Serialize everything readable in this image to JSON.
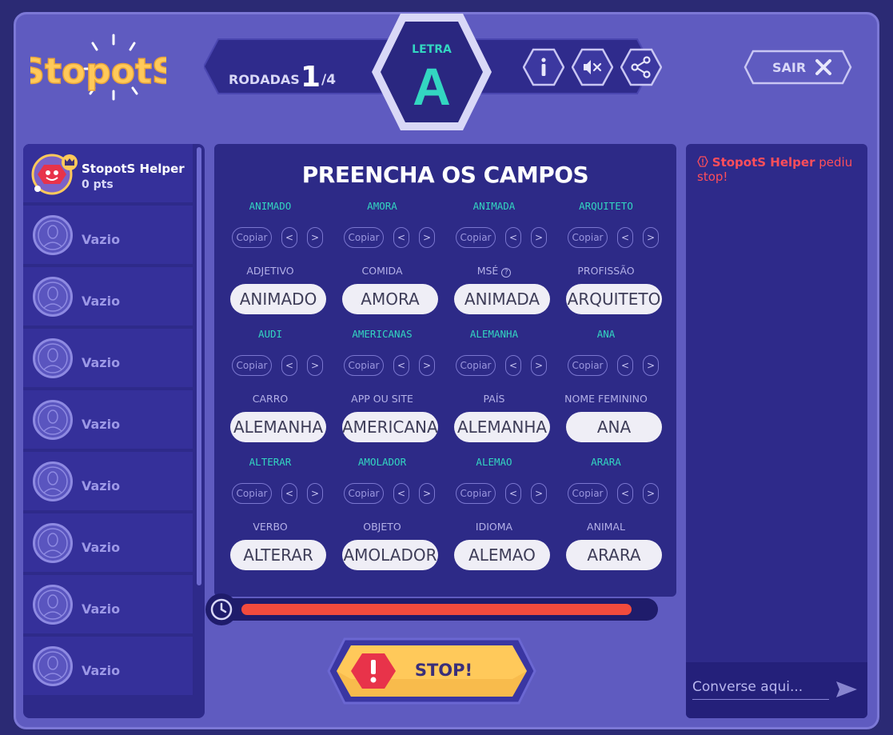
{
  "header": {
    "logo_text": "StopotS",
    "rounds_label": "RODADAS",
    "rounds_current": "1",
    "rounds_total": "/4",
    "letter_label": "LETRA",
    "letter": "A",
    "exit_label": "SAIR"
  },
  "icons": {
    "info": "info-icon",
    "sound": "mute-icon",
    "share": "share-icon",
    "close": "close-icon",
    "clock": "clock-icon",
    "alert": "exclamation-icon",
    "send": "send-icon",
    "crown": "crown-icon"
  },
  "players": [
    {
      "name": "StopotS Helper",
      "points": "0 pts"
    },
    {
      "name": "Vazio"
    },
    {
      "name": "Vazio"
    },
    {
      "name": "Vazio"
    },
    {
      "name": "Vazio"
    },
    {
      "name": "Vazio"
    },
    {
      "name": "Vazio"
    },
    {
      "name": "Vazio"
    },
    {
      "name": "Vazio"
    }
  ],
  "board": {
    "title": "PREENCHA OS CAMPOS",
    "copy_label": "Copiar",
    "prev_label": "<",
    "next_label": ">",
    "fields": [
      {
        "suggestion": "ANIMADO",
        "category": "ADJETIVO",
        "answer": "ANIMADO"
      },
      {
        "suggestion": "AMORA",
        "category": "COMIDA",
        "answer": "AMORA"
      },
      {
        "suggestion": "ANIMADA",
        "category": "MSÉ",
        "answer": "ANIMADA",
        "help": "?"
      },
      {
        "suggestion": "ARQUITETO",
        "category": "PROFISSÃO",
        "answer": "ARQUITETO"
      },
      {
        "suggestion": "AUDI",
        "category": "CARRO",
        "answer": "ALEMANHA"
      },
      {
        "suggestion": "AMERICANAS",
        "category": "APP OU SITE",
        "answer": "AMERICANAS"
      },
      {
        "suggestion": "ALEMANHA",
        "category": "PAÍS",
        "answer": "ALEMANHA"
      },
      {
        "suggestion": "ANA",
        "category": "NOME FEMININO",
        "answer": "ANA"
      },
      {
        "suggestion": "ALTERAR",
        "category": "VERBO",
        "answer": "ALTERAR"
      },
      {
        "suggestion": "AMOLADOR",
        "category": "OBJETO",
        "answer": "AMOLADOR"
      },
      {
        "suggestion": "ALEMAO",
        "category": "IDIOMA",
        "answer": "ALEMAO"
      },
      {
        "suggestion": "ARARA",
        "category": "ANIMAL",
        "answer": "ARARA"
      }
    ]
  },
  "timer": {
    "remaining_fraction": 0.97,
    "bar_color": "#f24b3d"
  },
  "stop_label": "STOP!",
  "chat": {
    "messages": [
      {
        "author": "StopotS Helper",
        "text": " pediu stop!"
      }
    ],
    "placeholder": "Converse aqui..."
  },
  "colors": {
    "accent_teal": "#33d6c1",
    "background": "#5f5bc0",
    "panel": "#2d2a87",
    "stop_yellow": "#ffc95a",
    "alert_red": "#ff4e5a"
  }
}
